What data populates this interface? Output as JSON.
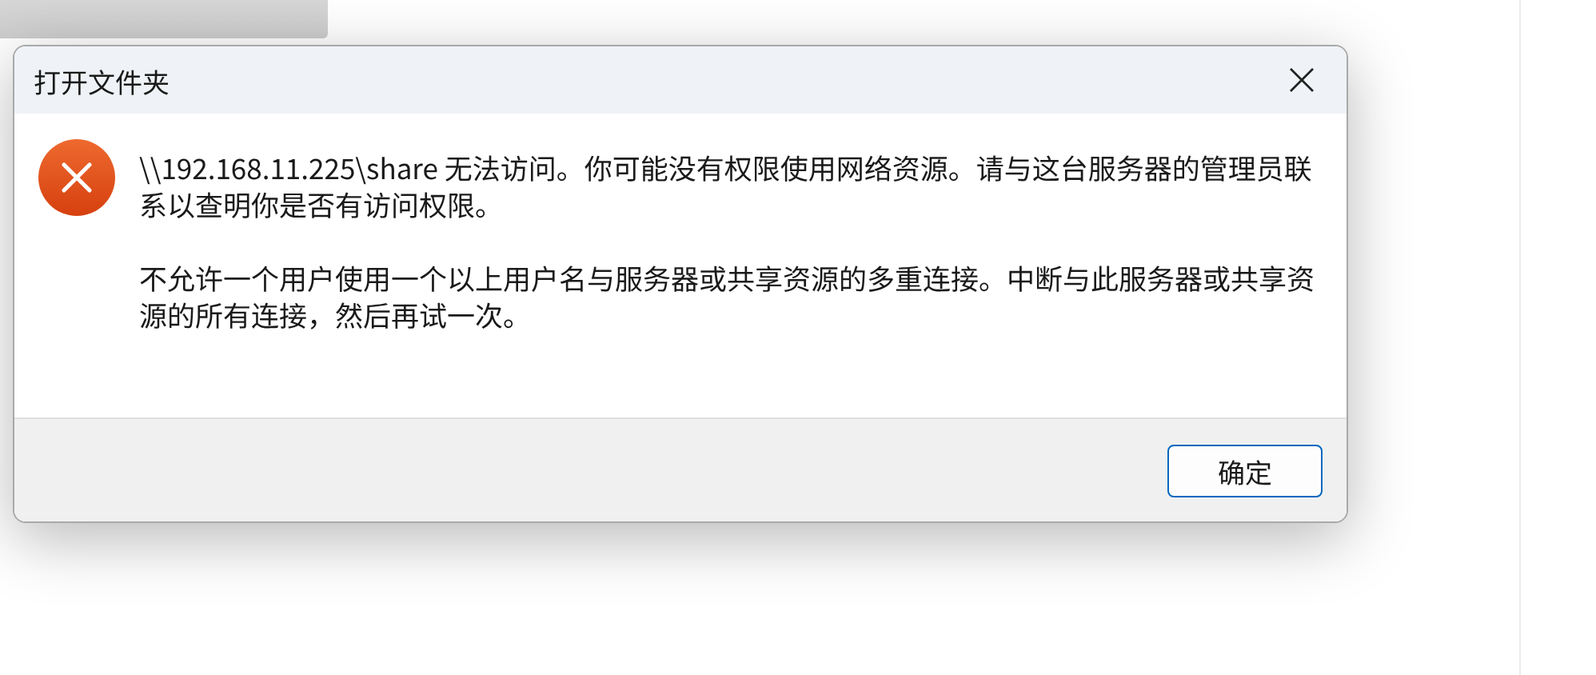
{
  "dialog": {
    "title": "打开文件夹",
    "paragraphs": [
      "\\\\192.168.11.225\\share 无法访问。你可能没有权限使用网络资源。请与这台服务器的管理员联系以查明你是否有访问权限。",
      "不允许一个用户使用一个以上用户名与服务器或共享资源的多重连接。中断与此服务器或共享资源的所有连接，然后再试一次。"
    ],
    "buttons": [
      "确定"
    ]
  }
}
